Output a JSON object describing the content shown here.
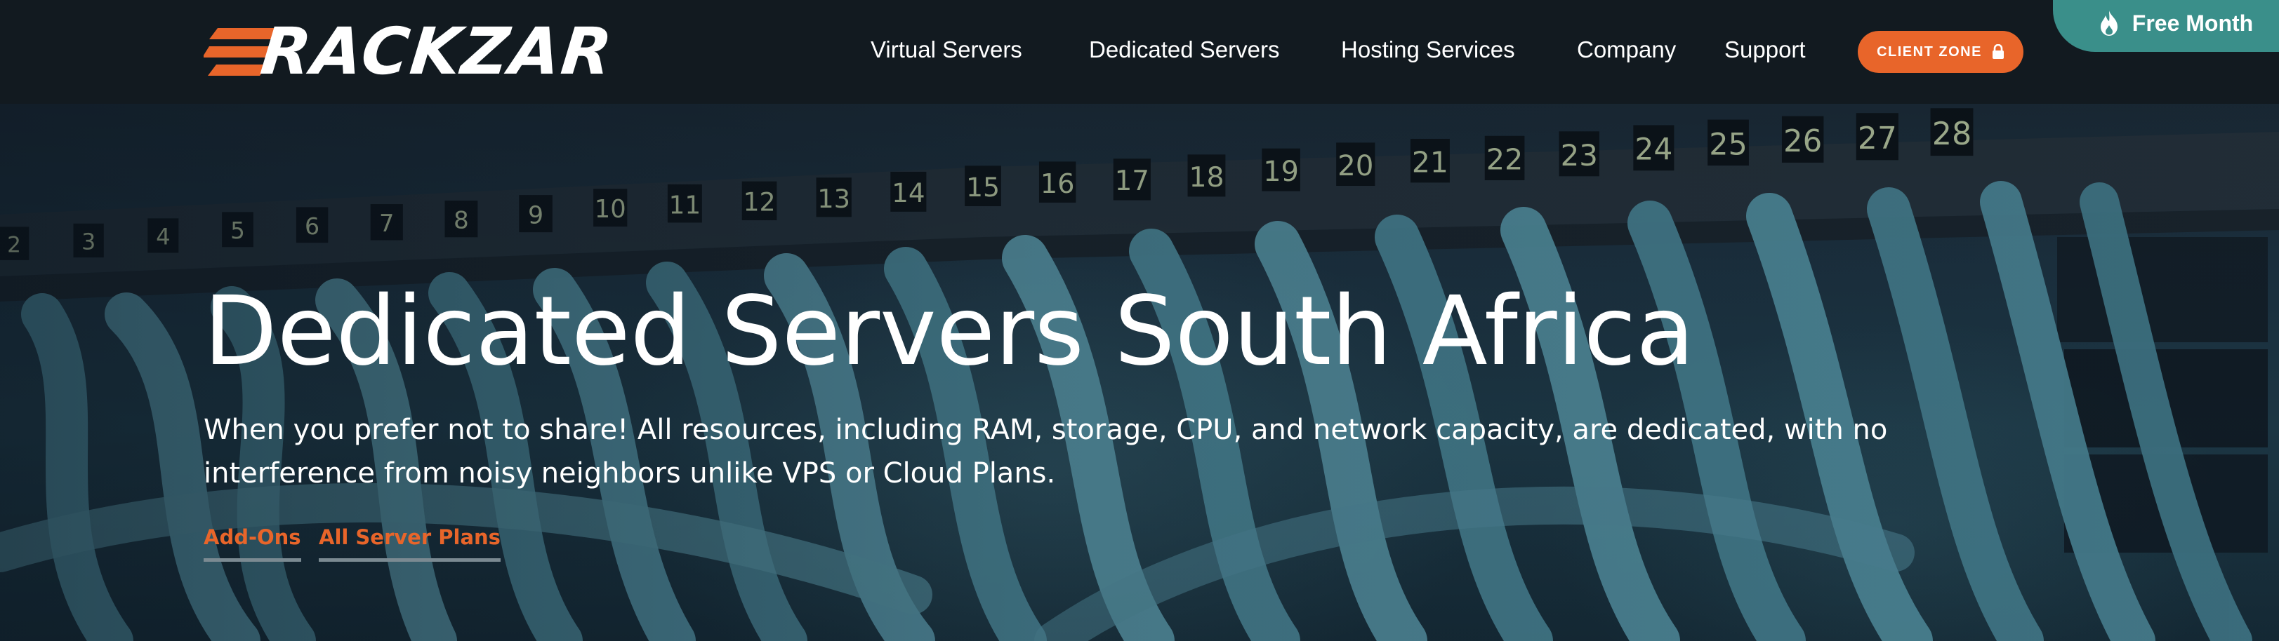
{
  "header": {
    "logo_text": "RACKZAR",
    "nav": [
      {
        "label": "Virtual Servers"
      },
      {
        "label": "Dedicated Servers"
      },
      {
        "label": "Hosting Services"
      },
      {
        "label": "Company"
      },
      {
        "label": "Support"
      }
    ],
    "client_zone": {
      "label": "CLIENT ZONE",
      "icon": "lock-icon"
    },
    "promo": {
      "label": "Free Month",
      "icon": "flame-icon"
    }
  },
  "hero": {
    "title": "Dedicated Servers South Africa",
    "description": "When you prefer not to share! All resources, including RAM, storage, CPU, and network capacity, are dedicated, with no interference from noisy neighbors unlike VPS or Cloud Plans.",
    "links": [
      {
        "label": "Add-Ons"
      },
      {
        "label": "All Server Plans"
      }
    ],
    "patch_panel_ports": [
      "2",
      "3",
      "4",
      "5",
      "6",
      "7",
      "8",
      "9",
      "10",
      "11",
      "12",
      "13",
      "14",
      "15",
      "16",
      "17",
      "18",
      "19",
      "20",
      "21",
      "22",
      "23",
      "24",
      "25",
      "26",
      "27",
      "28"
    ]
  },
  "colors": {
    "header_bg": "#121a20",
    "accent_orange": "#e8652a",
    "promo_teal": "#3a8f8a",
    "link_underline": "#7b8a92"
  }
}
